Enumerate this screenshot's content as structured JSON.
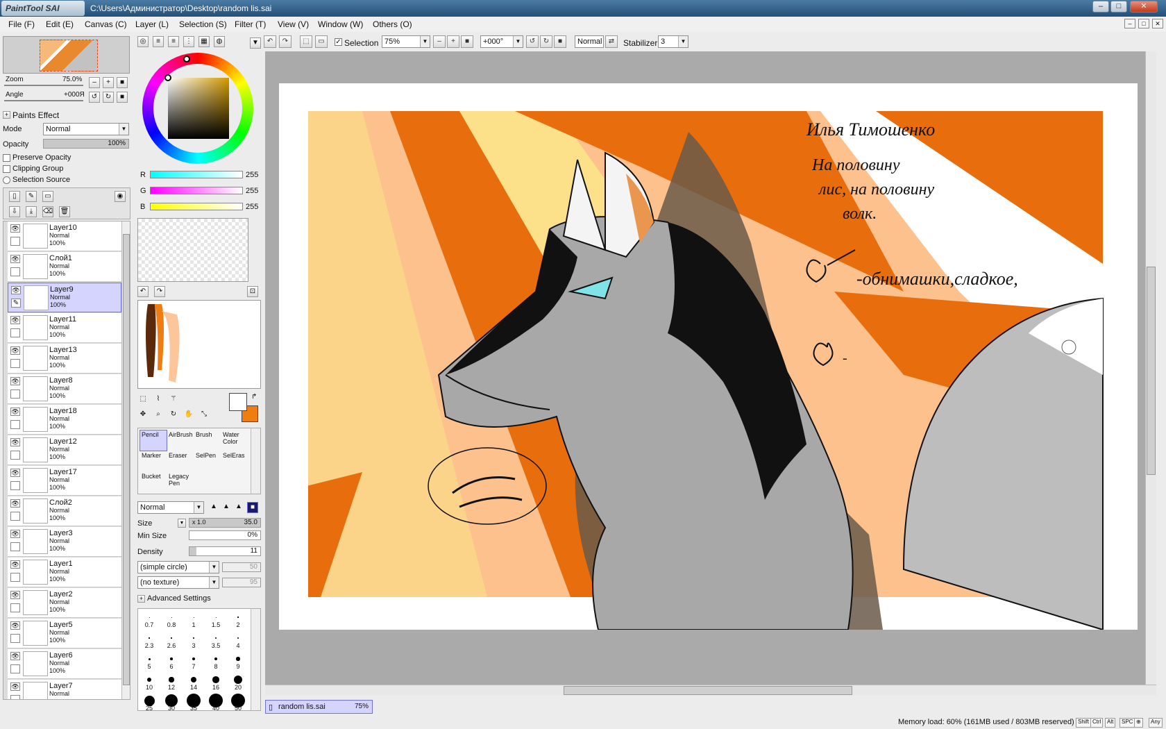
{
  "window": {
    "app_logo": "PaintTool SAI",
    "title": "C:\\Users\\Администратор\\Desktop\\random lis.sai",
    "minimize": "–",
    "maximize": "□",
    "close": "✕"
  },
  "menu": [
    "File (F)",
    "Edit (E)",
    "Canvas (C)",
    "Layer (L)",
    "Selection (S)",
    "Filter (T)",
    "View (V)",
    "Window (W)",
    "Others (O)"
  ],
  "toolbar": {
    "selection_label": "Selection",
    "selection_checked": true,
    "zoom_value": "75%",
    "angle_value": "+000°",
    "blend_mode": "Normal",
    "stabilizer_label": "Stabilizer",
    "stabilizer_value": "3"
  },
  "navigator": {
    "zoom_label": "Zoom",
    "zoom_value": "75.0%",
    "angle_label": "Angle",
    "angle_value": "+000Я"
  },
  "layer_props": {
    "paints_effect": "Paints Effect",
    "mode_label": "Mode",
    "mode_value": "Normal",
    "opacity_label": "Opacity",
    "opacity_value": "100%",
    "preserve_opacity": "Preserve Opacity",
    "clipping_group": "Clipping Group",
    "selection_source": "Selection Source"
  },
  "layers": [
    {
      "name": "Layer10",
      "mode": "Normal",
      "opacity": "100%",
      "selected": false
    },
    {
      "name": "Слой1",
      "mode": "Normal",
      "opacity": "100%",
      "selected": false
    },
    {
      "name": "Layer9",
      "mode": "Normal",
      "opacity": "100%",
      "selected": true
    },
    {
      "name": "Layer11",
      "mode": "Normal",
      "opacity": "100%",
      "selected": false
    },
    {
      "name": "Layer13",
      "mode": "Normal",
      "opacity": "100%",
      "selected": false
    },
    {
      "name": "Layer8",
      "mode": "Normal",
      "opacity": "100%",
      "selected": false
    },
    {
      "name": "Layer18",
      "mode": "Normal",
      "opacity": "100%",
      "selected": false
    },
    {
      "name": "Layer12",
      "mode": "Normal",
      "opacity": "100%",
      "selected": false
    },
    {
      "name": "Layer17",
      "mode": "Normal",
      "opacity": "100%",
      "selected": false
    },
    {
      "name": "Слой2",
      "mode": "Normal",
      "opacity": "100%",
      "selected": false
    },
    {
      "name": "Layer3",
      "mode": "Normal",
      "opacity": "100%",
      "selected": false
    },
    {
      "name": "Layer1",
      "mode": "Normal",
      "opacity": "100%",
      "selected": false
    },
    {
      "name": "Layer2",
      "mode": "Normal",
      "opacity": "100%",
      "selected": false
    },
    {
      "name": "Layer5",
      "mode": "Normal",
      "opacity": "100%",
      "selected": false
    },
    {
      "name": "Layer6",
      "mode": "Normal",
      "opacity": "100%",
      "selected": false
    },
    {
      "name": "Layer7",
      "mode": "Normal",
      "opacity": "",
      "selected": false
    }
  ],
  "color": {
    "r_label": "R",
    "r_value": "255",
    "g_label": "G",
    "g_value": "255",
    "b_label": "B",
    "b_value": "255",
    "foreground": "#ffffff",
    "background": "#f07d12"
  },
  "tools": [
    {
      "label": "Pencil",
      "selected": true
    },
    {
      "label": "AirBrush",
      "selected": false
    },
    {
      "label": "Brush",
      "selected": false
    },
    {
      "label": "Water Color",
      "selected": false
    },
    {
      "label": "Marker",
      "selected": false
    },
    {
      "label": "Eraser",
      "selected": false
    },
    {
      "label": "SelPen",
      "selected": false
    },
    {
      "label": "SelEras",
      "selected": false
    },
    {
      "label": "Bucket",
      "selected": false
    },
    {
      "label": "Legacy Pen",
      "selected": false
    }
  ],
  "brush": {
    "mode": "Normal",
    "size_label": "Size",
    "size_mult": "x 1.0",
    "size_value": "35.0",
    "min_size_label": "Min Size",
    "min_size_value": "0%",
    "density_label": "Density",
    "density_value": "11",
    "shape": "(simple circle)",
    "shape_value": "50",
    "texture": "(no texture)",
    "texture_value": "95",
    "advanced": "Advanced Settings",
    "sizes": [
      "0.7",
      "0.8",
      "1",
      "1.5",
      "2",
      "2.3",
      "2.6",
      "3",
      "3.5",
      "4",
      "5",
      "6",
      "7",
      "8",
      "9",
      "10",
      "12",
      "14",
      "16",
      "20",
      "25",
      "30",
      "35",
      "40",
      "50"
    ]
  },
  "document_tab": {
    "name": "random lis.sai",
    "zoom": "75%"
  },
  "artwork": {
    "line1": "Илья Тимошенко",
    "line2": "На половину",
    "line3": "лис, на половину",
    "line4": "волк.",
    "line5": "-обнимашки,сладкое,",
    "line6": "-"
  },
  "status": {
    "memory": "Memory load: 60% (161MB used / 803MB reserved)",
    "keys": [
      "Shift",
      "Ctrl",
      "Alt",
      "SPC",
      "⊕",
      "Any"
    ]
  }
}
